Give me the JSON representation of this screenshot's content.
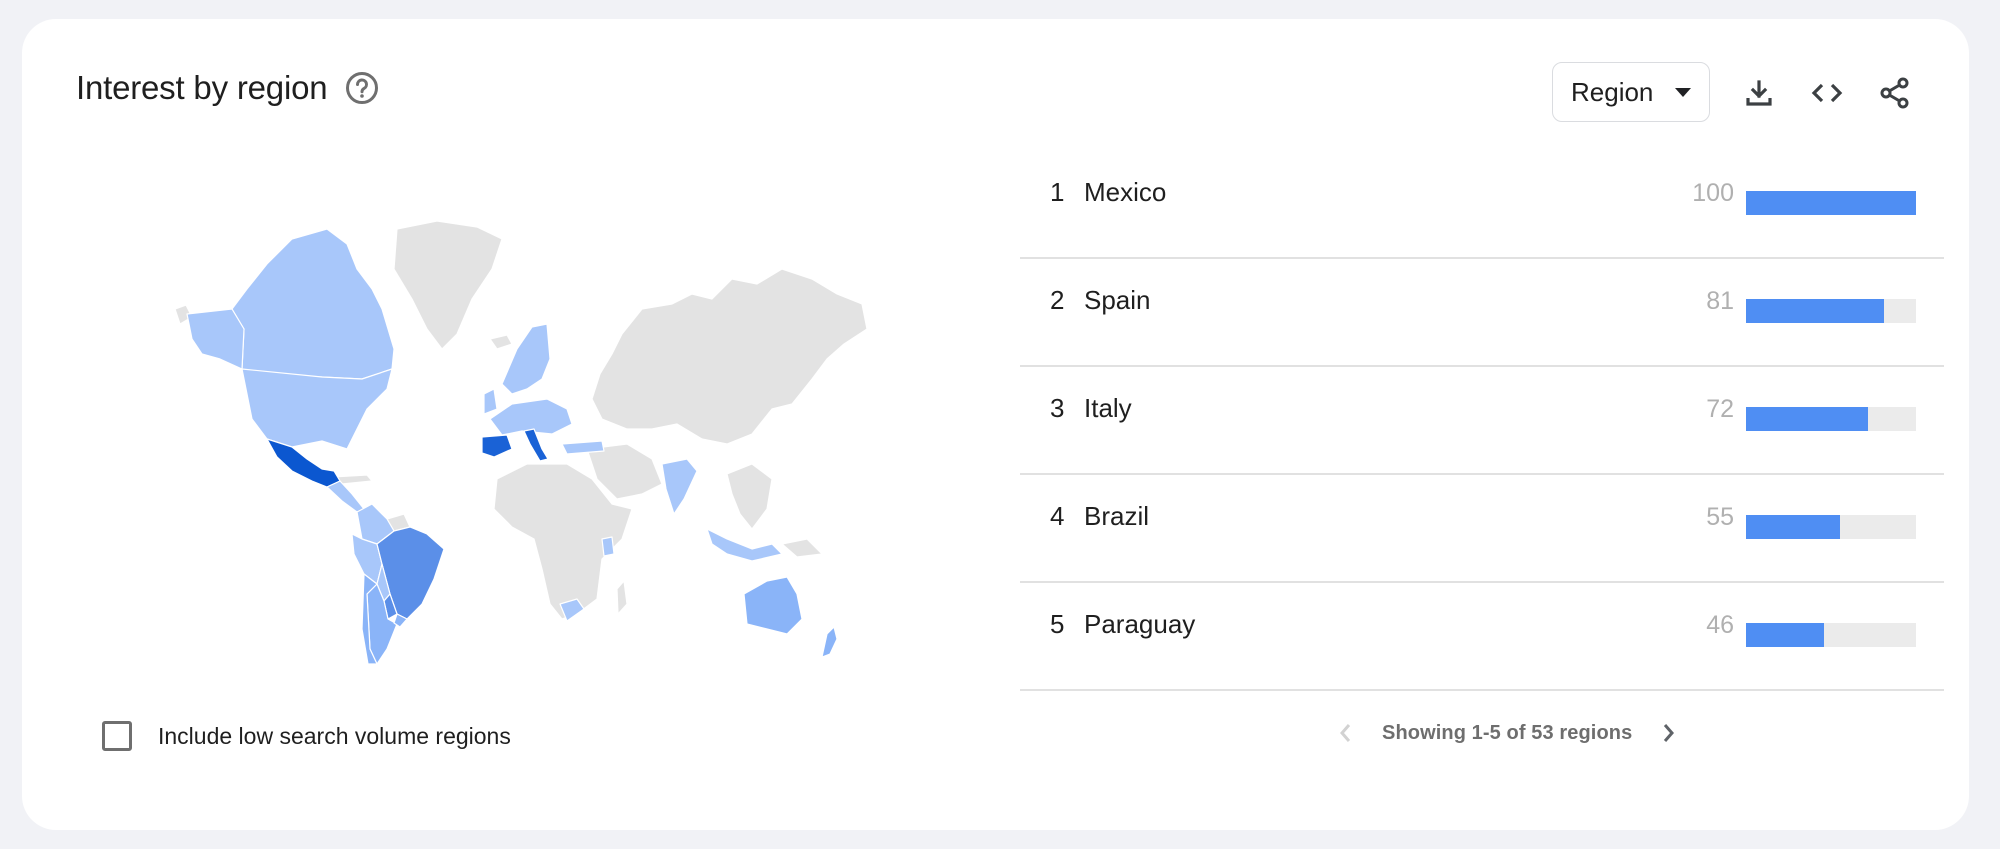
{
  "widget": {
    "title": "Interest by region",
    "help_icon": "help-circle-icon",
    "resolution_select": {
      "selected": "Region"
    },
    "toolbar": {
      "icons": [
        "download-icon",
        "embed-code-icon",
        "share-icon"
      ]
    },
    "include_low_volume": {
      "label": "Include low search volume regions",
      "checked": false
    },
    "pagination": {
      "text": "Showing 1-5 of 53 regions",
      "prev_enabled": false,
      "next_enabled": true
    }
  },
  "colors": {
    "bar_fill": "#4f8ef3",
    "bar_track": "#ebebeb",
    "map_no_data": "#e3e3e3",
    "map_scale": [
      "#a8c7fa",
      "#8ab4f8",
      "#5b8fe8",
      "#1a62d6",
      "#0b57d0"
    ]
  },
  "chart_data": {
    "type": "table",
    "title": "Interest by region",
    "value_range": [
      0,
      100
    ],
    "rows": [
      {
        "rank": "1",
        "region": "Mexico",
        "value": 100
      },
      {
        "rank": "2",
        "region": "Spain",
        "value": 81
      },
      {
        "rank": "3",
        "region": "Italy",
        "value": 72
      },
      {
        "rank": "4",
        "region": "Brazil",
        "value": 55
      },
      {
        "rank": "5",
        "region": "Paraguay",
        "value": 46
      }
    ],
    "map_shading": [
      {
        "region": "Mexico",
        "level": 4
      },
      {
        "region": "Spain",
        "level": 3
      },
      {
        "region": "Italy",
        "level": 3
      },
      {
        "region": "Brazil",
        "level": 2
      },
      {
        "region": "Paraguay",
        "level": 2
      },
      {
        "region": "Argentina",
        "level": 1
      },
      {
        "region": "Chile",
        "level": 1
      },
      {
        "region": "Uruguay",
        "level": 1
      },
      {
        "region": "Australia",
        "level": 1
      },
      {
        "region": "Colombia",
        "level": 0
      },
      {
        "region": "Venezuela",
        "level": 0
      },
      {
        "region": "Peru",
        "level": 0
      },
      {
        "region": "Bolivia",
        "level": 0
      },
      {
        "region": "Ecuador",
        "level": 0
      },
      {
        "region": "Central America",
        "level": 0
      },
      {
        "region": "United States",
        "level": 0
      },
      {
        "region": "Canada",
        "level": 0
      },
      {
        "region": "Western Europe",
        "level": 0
      },
      {
        "region": "Scandinavia",
        "level": 0
      },
      {
        "region": "Eastern Europe",
        "level": 0
      },
      {
        "region": "Turkey",
        "level": 0
      },
      {
        "region": "India",
        "level": 0
      },
      {
        "region": "Indonesia",
        "level": 0
      },
      {
        "region": "Philippines",
        "level": 0
      },
      {
        "region": "Kenya",
        "level": 0
      },
      {
        "region": "South Africa",
        "level": 0
      },
      {
        "region": "New Zealand",
        "level": 1
      }
    ]
  }
}
